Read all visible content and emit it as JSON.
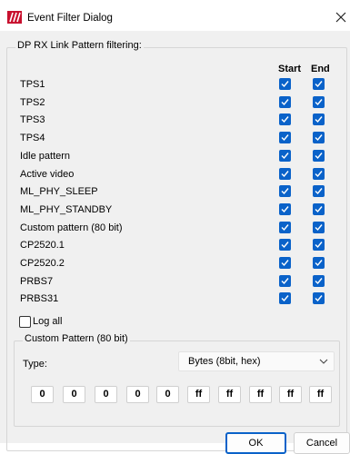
{
  "window": {
    "title": "Event Filter Dialog",
    "accent": "#0a62c9"
  },
  "filter_group": {
    "title": "DP RX Link Pattern filtering:",
    "col_start": "Start",
    "col_end": "End",
    "rows": [
      {
        "label": "TPS1",
        "start": true,
        "end": true
      },
      {
        "label": "TPS2",
        "start": true,
        "end": true
      },
      {
        "label": "TPS3",
        "start": true,
        "end": true
      },
      {
        "label": "TPS4",
        "start": true,
        "end": true
      },
      {
        "label": "Idle pattern",
        "start": true,
        "end": true
      },
      {
        "label": "Active video",
        "start": true,
        "end": true
      },
      {
        "label": "ML_PHY_SLEEP",
        "start": true,
        "end": true
      },
      {
        "label": "ML_PHY_STANDBY",
        "start": true,
        "end": true
      },
      {
        "label": "Custom pattern (80 bit)",
        "start": true,
        "end": true
      },
      {
        "label": "CP2520.1",
        "start": true,
        "end": true
      },
      {
        "label": "CP2520.2",
        "start": true,
        "end": true
      },
      {
        "label": "PRBS7",
        "start": true,
        "end": true
      },
      {
        "label": "PRBS31",
        "start": true,
        "end": true
      }
    ],
    "log_all": {
      "label": "Log all",
      "checked": false
    }
  },
  "custom_pattern": {
    "title": "Custom Pattern (80 bit)",
    "type_label": "Type:",
    "type_value": "Bytes (8bit, hex)",
    "bytes": [
      "0",
      "0",
      "0",
      "0",
      "0",
      "ff",
      "ff",
      "ff",
      "ff",
      "ff"
    ]
  },
  "buttons": {
    "ok": "OK",
    "cancel": "Cancel"
  }
}
